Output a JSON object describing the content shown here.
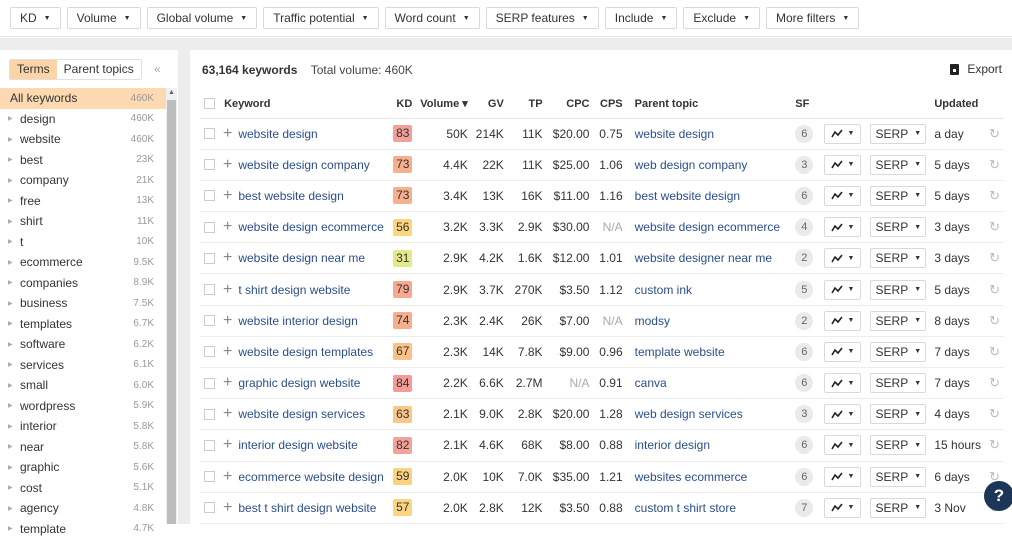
{
  "filters": [
    {
      "label": "KD"
    },
    {
      "label": "Volume"
    },
    {
      "label": "Global volume"
    },
    {
      "label": "Traffic potential"
    },
    {
      "label": "Word count"
    },
    {
      "label": "SERP features"
    },
    {
      "label": "Include"
    },
    {
      "label": "Exclude"
    },
    {
      "label": "More filters"
    }
  ],
  "sidebar": {
    "tabs": [
      {
        "label": "Terms",
        "active": true
      },
      {
        "label": "Parent topics",
        "active": false
      }
    ],
    "collapse_icon": "double-chevron-left",
    "all_keywords": {
      "label": "All keywords",
      "count": "460K"
    },
    "terms": [
      {
        "label": "design",
        "count": "460K"
      },
      {
        "label": "website",
        "count": "460K"
      },
      {
        "label": "best",
        "count": "23K"
      },
      {
        "label": "company",
        "count": "21K"
      },
      {
        "label": "free",
        "count": "13K"
      },
      {
        "label": "shirt",
        "count": "11K"
      },
      {
        "label": "t",
        "count": "10K"
      },
      {
        "label": "ecommerce",
        "count": "9.5K"
      },
      {
        "label": "companies",
        "count": "8.9K"
      },
      {
        "label": "business",
        "count": "7.5K"
      },
      {
        "label": "templates",
        "count": "6.7K"
      },
      {
        "label": "software",
        "count": "6.2K"
      },
      {
        "label": "services",
        "count": "6.1K"
      },
      {
        "label": "small",
        "count": "6.0K"
      },
      {
        "label": "wordpress",
        "count": "5.9K"
      },
      {
        "label": "interior",
        "count": "5.8K"
      },
      {
        "label": "near",
        "count": "5.8K"
      },
      {
        "label": "graphic",
        "count": "5.6K"
      },
      {
        "label": "cost",
        "count": "5.1K"
      },
      {
        "label": "agency",
        "count": "4.8K"
      },
      {
        "label": "template",
        "count": "4.7K"
      }
    ]
  },
  "summary": {
    "keywords_count": "63,164 keywords",
    "total_volume": "Total volume: 460K",
    "export_label": "Export"
  },
  "table": {
    "headers": {
      "keyword": "Keyword",
      "kd": "KD",
      "volume": "Volume ▾",
      "gv": "GV",
      "tp": "TP",
      "cpc": "CPC",
      "cps": "CPS",
      "parent": "Parent topic",
      "sf": "SF",
      "updated": "Updated"
    },
    "serp_label": "SERP",
    "kd_colors": {
      "83": "#f4a09a",
      "73": "#f7b08d",
      "56": "#fbd67f",
      "31": "#e3e98a",
      "79": "#f7a88e",
      "74": "#f7ae8d",
      "67": "#f9c286",
      "84": "#f49c98",
      "63": "#f9c788",
      "82": "#f4a39a",
      "59": "#fbd37f",
      "57": "#fbd580"
    },
    "rows": [
      {
        "keyword": "website design",
        "kd": "83",
        "volume": "50K",
        "gv": "214K",
        "tp": "11K",
        "cpc": "$20.00",
        "cps": "0.75",
        "parent": "website design",
        "sf": "6",
        "updated": "a day"
      },
      {
        "keyword": "website design company",
        "kd": "73",
        "volume": "4.4K",
        "gv": "22K",
        "tp": "11K",
        "cpc": "$25.00",
        "cps": "1.06",
        "parent": "web design company",
        "sf": "3",
        "updated": "5 days"
      },
      {
        "keyword": "best website design",
        "kd": "73",
        "volume": "3.4K",
        "gv": "13K",
        "tp": "16K",
        "cpc": "$11.00",
        "cps": "1.16",
        "parent": "best website design",
        "sf": "6",
        "updated": "5 days"
      },
      {
        "keyword": "website design ecommerce",
        "kd": "56",
        "volume": "3.2K",
        "gv": "3.3K",
        "tp": "2.9K",
        "cpc": "$30.00",
        "cps": "N/A",
        "parent": "website design ecommerce",
        "sf": "4",
        "updated": "3 days"
      },
      {
        "keyword": "website design near me",
        "kd": "31",
        "volume": "2.9K",
        "gv": "4.2K",
        "tp": "1.6K",
        "cpc": "$12.00",
        "cps": "1.01",
        "parent": "website designer near me",
        "sf": "2",
        "updated": "3 days"
      },
      {
        "keyword": "t shirt design website",
        "kd": "79",
        "volume": "2.9K",
        "gv": "3.7K",
        "tp": "270K",
        "cpc": "$3.50",
        "cps": "1.12",
        "parent": "custom ink",
        "sf": "5",
        "updated": "5 days"
      },
      {
        "keyword": "website interior design",
        "kd": "74",
        "volume": "2.3K",
        "gv": "2.4K",
        "tp": "26K",
        "cpc": "$7.00",
        "cps": "N/A",
        "parent": "modsy",
        "sf": "2",
        "updated": "8 days"
      },
      {
        "keyword": "website design templates",
        "kd": "67",
        "volume": "2.3K",
        "gv": "14K",
        "tp": "7.8K",
        "cpc": "$9.00",
        "cps": "0.96",
        "parent": "template website",
        "sf": "6",
        "updated": "7 days"
      },
      {
        "keyword": "graphic design website",
        "kd": "84",
        "volume": "2.2K",
        "gv": "6.6K",
        "tp": "2.7M",
        "cpc": "N/A",
        "cps": "0.91",
        "parent": "canva",
        "sf": "6",
        "updated": "7 days"
      },
      {
        "keyword": "website design services",
        "kd": "63",
        "volume": "2.1K",
        "gv": "9.0K",
        "tp": "2.8K",
        "cpc": "$20.00",
        "cps": "1.28",
        "parent": "web design services",
        "sf": "3",
        "updated": "4 days"
      },
      {
        "keyword": "interior design website",
        "kd": "82",
        "volume": "2.1K",
        "gv": "4.6K",
        "tp": "68K",
        "cpc": "$8.00",
        "cps": "0.88",
        "parent": "interior design",
        "sf": "6",
        "updated": "15 hours"
      },
      {
        "keyword": "ecommerce website design",
        "kd": "59",
        "volume": "2.0K",
        "gv": "10K",
        "tp": "7.0K",
        "cpc": "$35.00",
        "cps": "1.21",
        "parent": "websites ecommerce",
        "sf": "6",
        "updated": "6 days"
      },
      {
        "keyword": "best t shirt design website",
        "kd": "57",
        "volume": "2.0K",
        "gv": "2.8K",
        "tp": "12K",
        "cpc": "$3.50",
        "cps": "0.88",
        "parent": "custom t shirt store",
        "sf": "7",
        "updated": "3 Nov"
      }
    ]
  },
  "help_label": "?"
}
